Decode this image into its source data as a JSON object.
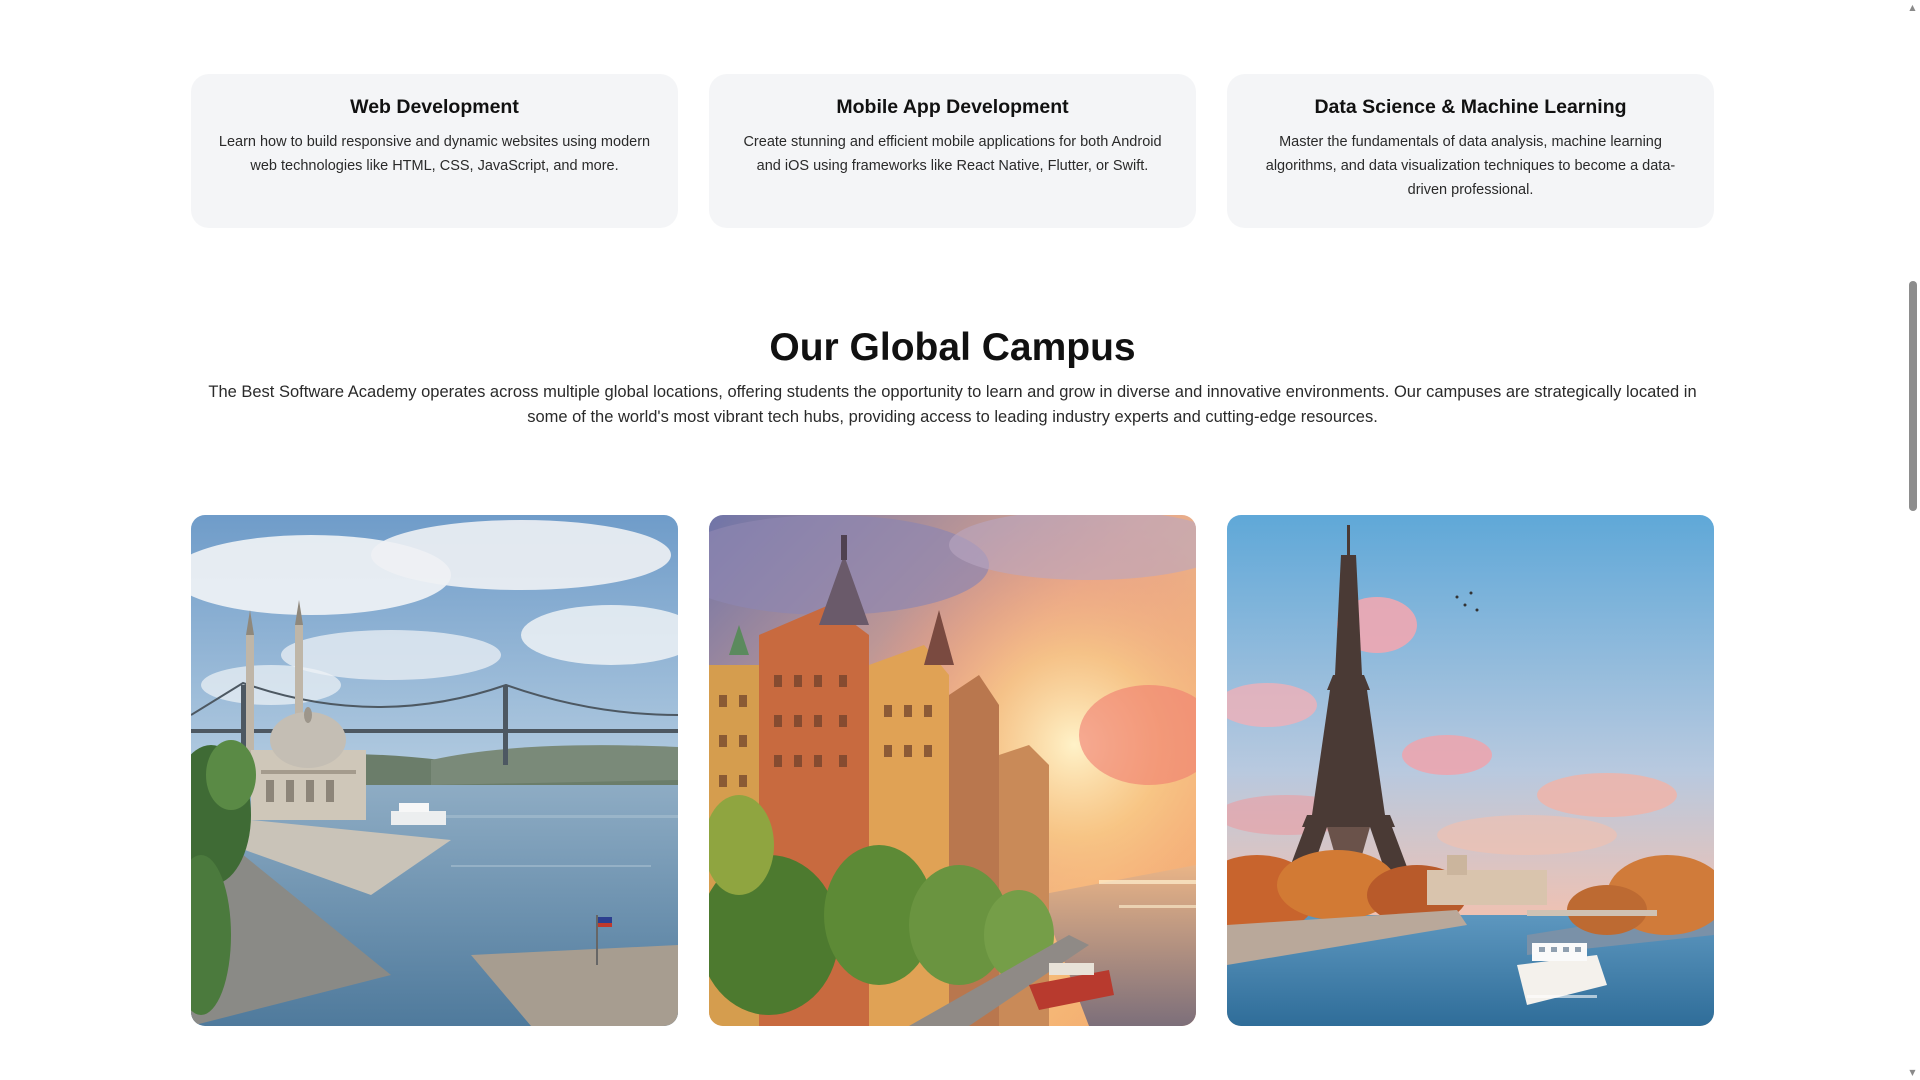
{
  "courses": [
    {
      "title": "Web Development",
      "description": "Learn how to build responsive and dynamic websites using modern web technologies like HTML, CSS, JavaScript, and more."
    },
    {
      "title": "Mobile App Development",
      "description": "Create stunning and efficient mobile applications for both Android and iOS using frameworks like React Native, Flutter, or Swift."
    },
    {
      "title": "Data Science & Machine Learning",
      "description": "Master the fundamentals of data analysis, machine learning algorithms, and data visualization techniques to become a data-driven professional."
    }
  ],
  "campus": {
    "title": "Our Global Campus",
    "description": "The Best Software Academy operates across multiple global locations, offering students the opportunity to learn and grow in diverse and innovative environments. Our campuses are strategically located in some of the world's most vibrant tech hubs, providing access to leading industry experts and cutting-edge resources."
  },
  "scrollbar": {
    "up_icon": "▲",
    "down_icon": "▼"
  },
  "colors": {
    "card_background": "#f4f5f7",
    "heading": "#111111",
    "body_text": "#2a2a2a",
    "scroll_thumb": "#8d8d8d"
  }
}
